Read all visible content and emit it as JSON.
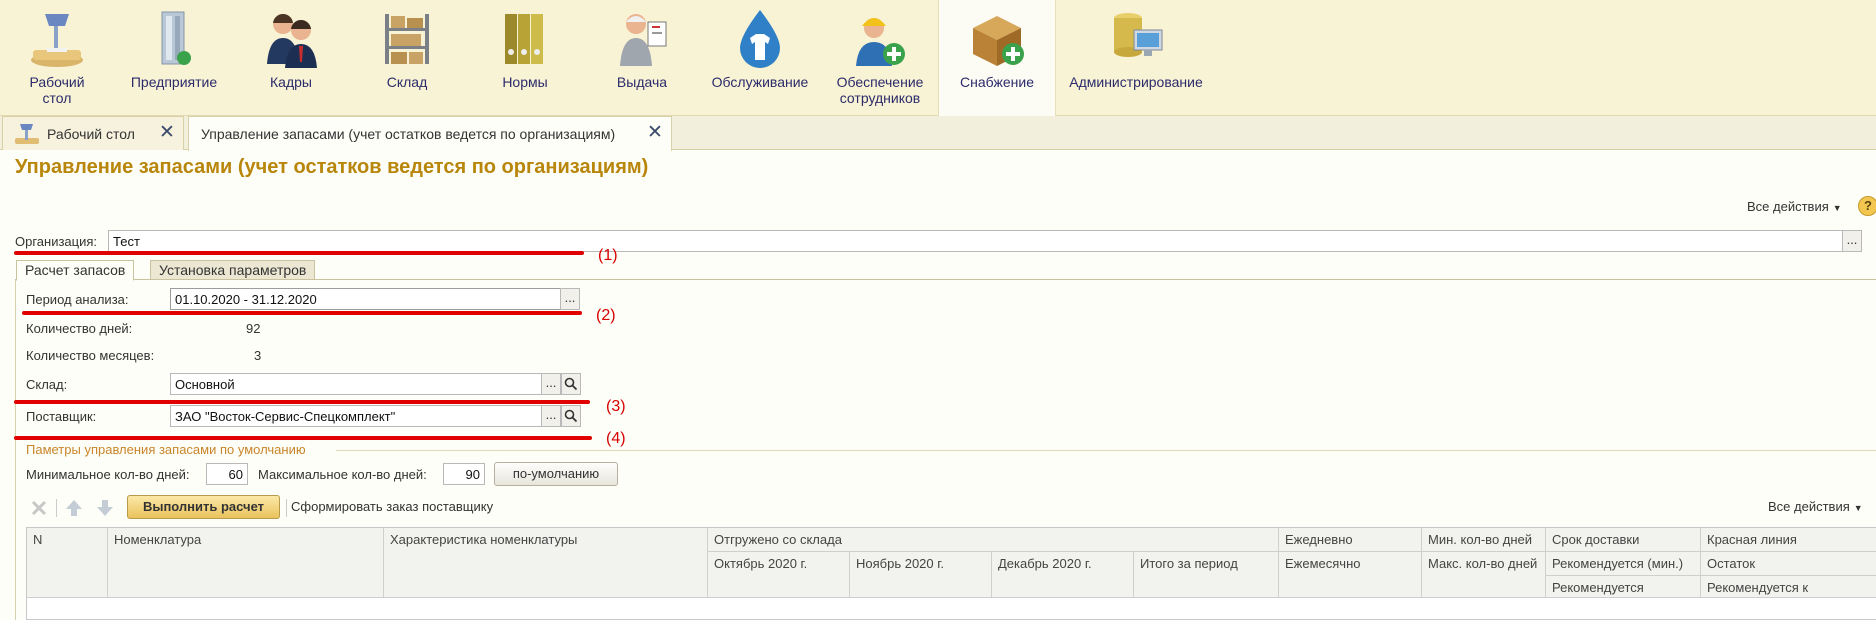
{
  "sections": [
    {
      "label": "Рабочий\nстол",
      "icon": "desk-lamp-icon"
    },
    {
      "label": "Предприятие",
      "icon": "building-icon"
    },
    {
      "label": "Кадры",
      "icon": "people-icon"
    },
    {
      "label": "Склад",
      "icon": "warehouse-shelves-icon"
    },
    {
      "label": "Нормы",
      "icon": "binders-icon"
    },
    {
      "label": "Выдача",
      "icon": "worker-issue-icon"
    },
    {
      "label": "Обслуживание",
      "icon": "water-drop-shirt-icon"
    },
    {
      "label": "Обеспечение\nсотрудников",
      "icon": "worker-add-icon"
    },
    {
      "label": "Снабжение",
      "icon": "box-add-icon",
      "active": true
    },
    {
      "label": "Администрирование",
      "icon": "database-computer-icon"
    }
  ],
  "open_tabs": [
    {
      "title": "Рабочий стол"
    },
    {
      "title": "Управление запасами (учет остатков ведется по организациям)",
      "active": true
    }
  ],
  "page": {
    "title": "Управление запасами (учет остатков ведется по организациям)",
    "all_actions": "Все действия",
    "help": "?"
  },
  "form": {
    "organization_label": "Организация:",
    "organization_value": "Тест",
    "field_btn_dots": "...",
    "inner_tabs": [
      "Расчет запасов",
      "Установка параметров"
    ],
    "period_label": "Период анализа:",
    "period_value": "01.10.2020 - 31.12.2020",
    "days_label": "Количество дней:",
    "days_value": "92",
    "months_label": "Количество месяцев:",
    "months_value": "3",
    "warehouse_label": "Склад:",
    "warehouse_value": "Основной",
    "supplier_label": "Поставщик:",
    "supplier_value": "ЗАО \"Восток-Сервис-Спецкомплект\"",
    "group_title": "Паметры управления запасами по умолчанию",
    "min_days_label": "Минимальное кол-во дней:",
    "min_days_value": "60",
    "max_days_label": "Максимальное кол-во дней:",
    "max_days_value": "90",
    "default_button": "по-умолчанию"
  },
  "annotations": [
    "(1)",
    "(2)",
    "(3)",
    "(4)"
  ],
  "toolbar": {
    "execute_button": "Выполнить расчет",
    "make_order": "Сформировать заказ поставщику",
    "all_actions": "Все действия"
  },
  "table": {
    "headers": {
      "n": "N",
      "nomenclature": "Номенклатура",
      "characteristic": "Характеристика номенклатуры",
      "shipped": "Отгружено со склада",
      "oct": "Октябрь 2020 г.",
      "nov": "Ноябрь 2020 г.",
      "dec": "Декабрь 2020 г.",
      "total": "Итого за период",
      "daily": "Ежедневно",
      "monthly": "Ежемесячно",
      "min_qty": "Мин. кол-во дней",
      "max_qty": "Макс. кол-во дней",
      "delivery": "Срок доставки",
      "recommended_min": "Рекомендуется (мин.)",
      "recommended": "Рекомендуется",
      "red_line": "Красная линия",
      "remainder": "Остаток",
      "recommended_to": "Рекомендуется к"
    }
  }
}
